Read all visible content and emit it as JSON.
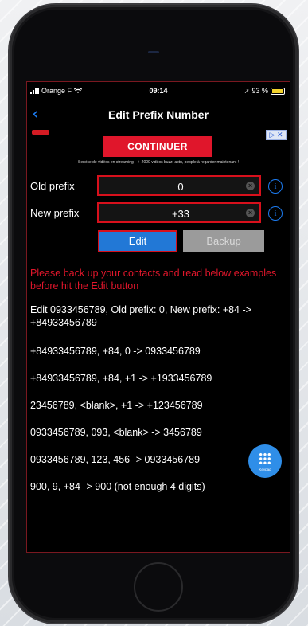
{
  "status_bar": {
    "carrier": "Orange F",
    "time": "09:14",
    "battery": "93 %"
  },
  "nav": {
    "back_glyph": "‹",
    "title": "Edit Prefix Number"
  },
  "ad": {
    "button": "CONTINUER",
    "tagline": "Service de vidéos en streaming – + 2000 vidéos buzz, actu, people à regarder maintenant !",
    "close": "▷ ✕"
  },
  "form": {
    "old_prefix": {
      "label": "Old prefix",
      "value": "0"
    },
    "new_prefix": {
      "label": "New prefix",
      "value": "+33"
    },
    "info_glyph": "i",
    "clear_glyph": "×"
  },
  "buttons": {
    "edit": "Edit",
    "backup": "Backup"
  },
  "warning": "Please back up your contacts and read below examples before hit the Edit button",
  "examples": [
    "Edit 0933456789, Old prefix: 0, New prefix: +84 -> +84933456789",
    "+84933456789, +84, 0 -> 0933456789",
    "+84933456789, +84, +1 -> +1933456789",
    "23456789, <blank>, +1 -> +123456789",
    "0933456789, 093, <blank> -> 3456789",
    "0933456789, 123, 456 -> 0933456789",
    "900, 9, +84 -> 900 (not enough 4 digits)"
  ],
  "fab": {
    "label": "Keypad"
  },
  "colors": {
    "accent_blue": "#2278d6",
    "highlight_red": "#d8101c",
    "warning_red": "#e0162b"
  }
}
